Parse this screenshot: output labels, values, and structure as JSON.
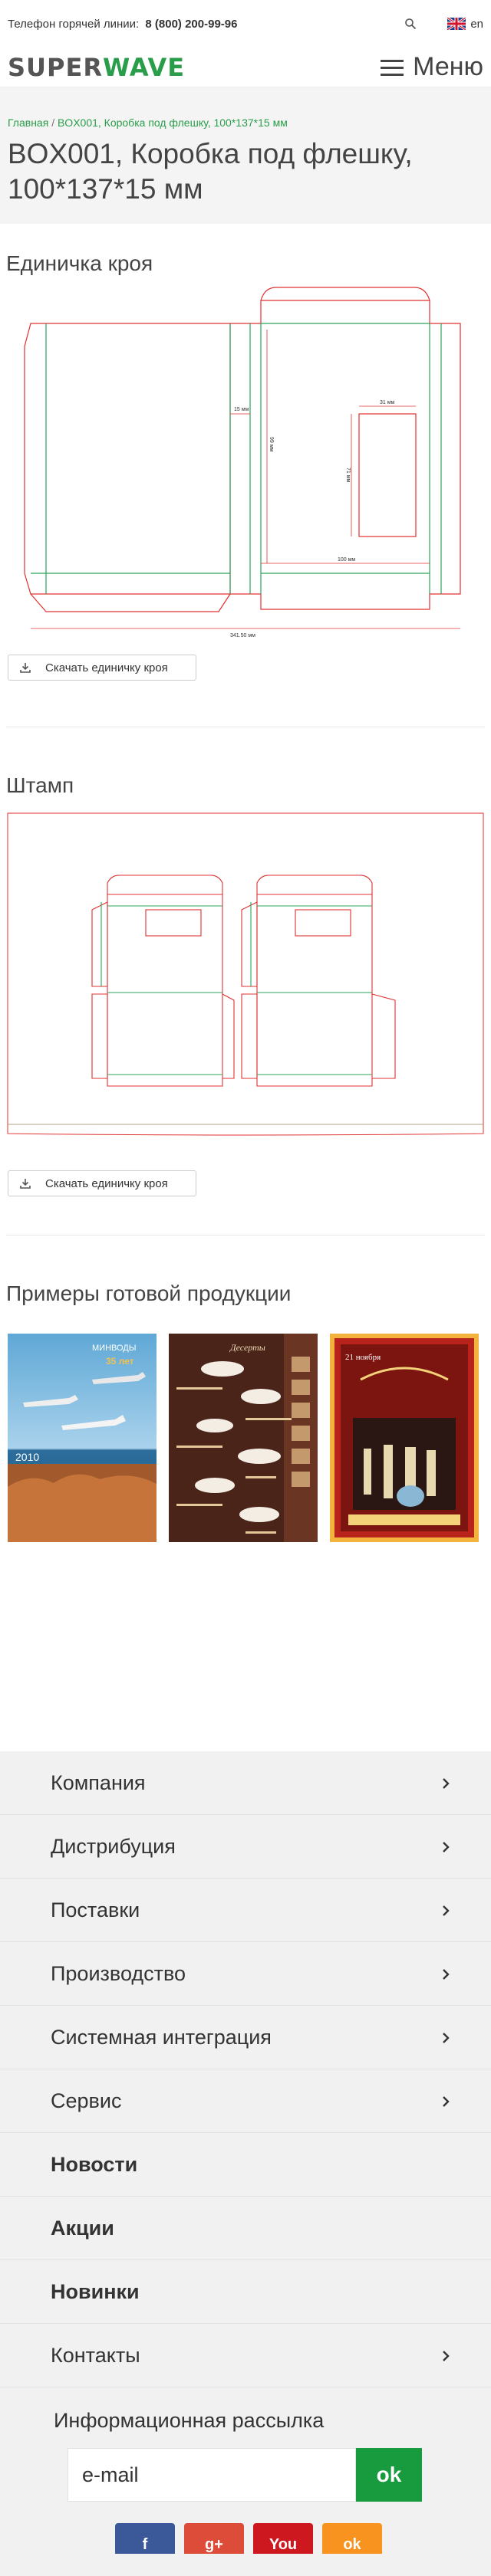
{
  "topbar": {
    "hotline_label": "Телефон горячей линии:",
    "hotline_number": "8 (800) 200-99-96",
    "lang": "en"
  },
  "header": {
    "logo_part1": "SUPER",
    "logo_part2": "WAVE",
    "menu_label": "Меню"
  },
  "breadcrumb": {
    "home": "Главная",
    "separator": "/",
    "current": "BOX001, Коробка под флешку, 100*137*15 мм"
  },
  "page": {
    "title": "BOX001, Коробка под флешку, 100*137*15 мм"
  },
  "die_cut": {
    "heading": "Единичка кроя",
    "dims": {
      "d15": "15 мм",
      "d31": "31 мм",
      "d71": "71 мм",
      "d99": "99 мм",
      "d100": "100 мм",
      "d341": "341.50 мм"
    },
    "download_label": "Скачать единичку кроя"
  },
  "stamp": {
    "heading": "Штамп",
    "download_label": "Скачать единичку кроя"
  },
  "examples": {
    "heading": "Примеры готовой продукции",
    "items": [
      {
        "name": "Airline calendar",
        "text1": "МИНВОДЫ",
        "text2": "35 лет",
        "year": "2010"
      },
      {
        "name": "Dessert menu",
        "text1": "Десерты"
      },
      {
        "name": "Event poster",
        "text1": "21 ноября"
      }
    ]
  },
  "footer": {
    "nav": [
      {
        "label": "Компания",
        "bold": false,
        "arrow": true
      },
      {
        "label": "Дистрибуция",
        "bold": false,
        "arrow": true
      },
      {
        "label": "Поставки",
        "bold": false,
        "arrow": true
      },
      {
        "label": "Производство",
        "bold": false,
        "arrow": true
      },
      {
        "label": "Системная интеграция",
        "bold": false,
        "arrow": true
      },
      {
        "label": "Сервис",
        "bold": false,
        "arrow": true
      },
      {
        "label": "Новости",
        "bold": true,
        "arrow": false
      },
      {
        "label": "Акции",
        "bold": true,
        "arrow": false
      },
      {
        "label": "Новинки",
        "bold": true,
        "arrow": false
      },
      {
        "label": "Контакты",
        "bold": false,
        "arrow": true
      }
    ],
    "newsletter": {
      "title": "Информационная рассылка",
      "email_placeholder": "e-mail",
      "submit_label": "ok"
    },
    "socials": [
      {
        "name": "facebook",
        "glyph": "f",
        "color": "#3b5998"
      },
      {
        "name": "google-plus",
        "glyph": "g+",
        "color": "#dd4b39"
      },
      {
        "name": "youtube",
        "glyph": "You",
        "color": "#cc181e"
      },
      {
        "name": "odnoklassniki",
        "glyph": "ok",
        "color": "#f7931e"
      }
    ]
  },
  "colors": {
    "accent": "#189a3e",
    "cut_line": "#e03030",
    "fold_line": "#2aa35a"
  }
}
